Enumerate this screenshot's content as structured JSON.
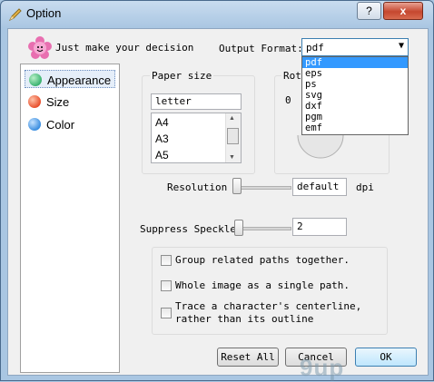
{
  "window": {
    "title": "Option",
    "help_label": "?",
    "close_label": "x"
  },
  "header": {
    "hint": "Just make your decision",
    "output_format_label": "Output Format:"
  },
  "output_format": {
    "selected": "pdf",
    "options": [
      "pdf",
      "eps",
      "ps",
      "svg",
      "dxf",
      "pgm",
      "emf"
    ]
  },
  "nav": [
    {
      "label": "Appearance",
      "color": "#3cb371"
    },
    {
      "label": "Size",
      "color": "#e8502e"
    },
    {
      "label": "Color",
      "color": "#3b8ee0"
    }
  ],
  "paper": {
    "label": "Paper size",
    "value": "letter",
    "items": [
      "A4",
      "A3",
      "A5"
    ]
  },
  "rotate": {
    "label": "Rot",
    "value": "0"
  },
  "resolution": {
    "label": "Resolution",
    "value": "default",
    "unit": "dpi"
  },
  "speckle": {
    "label": "Suppress Speckle:",
    "value": "2"
  },
  "options": [
    {
      "label": "Group related paths together."
    },
    {
      "label": "Whole image as a single path."
    },
    {
      "label": "Trace a character's centerline,\nrather than its outline"
    }
  ],
  "buttons": {
    "reset": "Reset All",
    "cancel": "Cancel",
    "ok": "OK"
  },
  "watermark": "9up"
}
